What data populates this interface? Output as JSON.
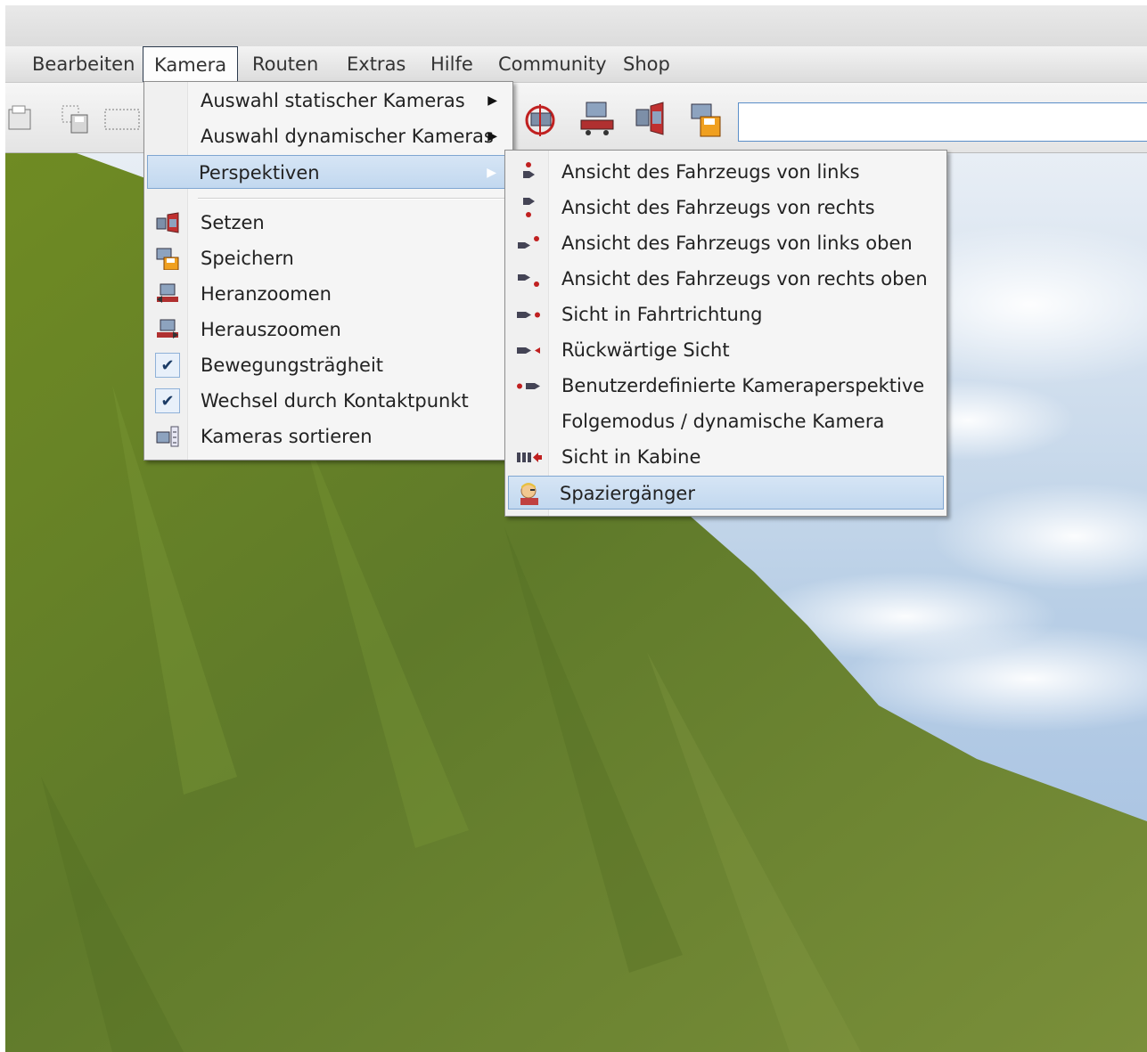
{
  "menubar": {
    "items": [
      "Bearbeiten",
      "Kamera",
      "Routen",
      "Extras",
      "Hilfe",
      "Community",
      "Shop"
    ]
  },
  "toolbar": {
    "search_value": ""
  },
  "kamera_menu": {
    "items": [
      {
        "label": "Auswahl statischer Kameras",
        "submenu": true
      },
      {
        "label": "Auswahl dynamischer Kameras",
        "submenu": true
      },
      {
        "label": "Perspektiven",
        "submenu": true,
        "highlighted": true
      },
      {
        "label": "Setzen",
        "icon": "camera-set-icon"
      },
      {
        "label": "Speichern",
        "icon": "camera-save-icon"
      },
      {
        "label": "Heranzoomen",
        "icon": "zoom-in-camera-icon"
      },
      {
        "label": "Herauszoomen",
        "icon": "zoom-out-camera-icon"
      },
      {
        "label": "Bewegungsträgheit",
        "checked": true
      },
      {
        "label": "Wechsel durch Kontaktpunkt",
        "checked": true
      },
      {
        "label": "Kameras sortieren",
        "icon": "sort-cameras-icon"
      }
    ]
  },
  "perspektiven_menu": {
    "items": [
      {
        "label": "Ansicht des Fahrzeugs von links",
        "icon": "view-left-icon"
      },
      {
        "label": "Ansicht des Fahrzeugs von rechts",
        "icon": "view-right-icon"
      },
      {
        "label": "Ansicht des Fahrzeugs von links oben",
        "icon": "view-left-top-icon"
      },
      {
        "label": "Ansicht des Fahrzeugs von rechts oben",
        "icon": "view-right-top-icon"
      },
      {
        "label": "Sicht in Fahrtrichtung",
        "icon": "view-forward-icon"
      },
      {
        "label": "Rückwärtige Sicht",
        "icon": "view-backward-icon"
      },
      {
        "label": "Benutzerdefinierte Kameraperspektive",
        "icon": "custom-view-icon"
      },
      {
        "label": "Folgemodus / dynamische Kamera"
      },
      {
        "label": "Sicht in Kabine",
        "icon": "cabin-view-icon"
      },
      {
        "label": "Spaziergänger",
        "icon": "pedestrian-icon",
        "highlighted": true
      }
    ]
  },
  "colors": {
    "highlight": "#c6dbf0",
    "highlight_border": "#7fa6d1",
    "grass": "#6f8a2a",
    "sky": "#bcd3ea"
  }
}
